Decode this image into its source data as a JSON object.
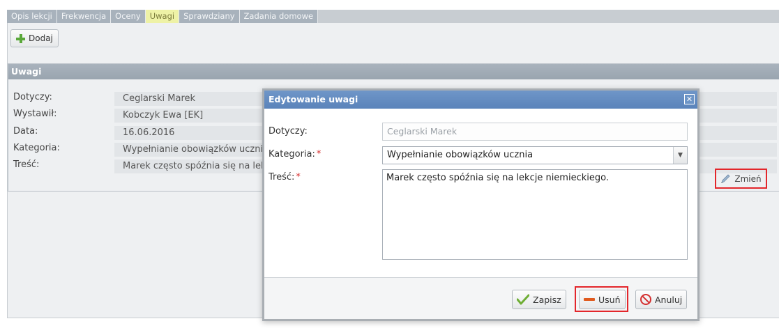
{
  "tabs": [
    {
      "label": "Opis lekcji",
      "active": false
    },
    {
      "label": "Frekwencja",
      "active": false
    },
    {
      "label": "Oceny",
      "active": false
    },
    {
      "label": "Uwagi",
      "active": true
    },
    {
      "label": "Sprawdziany",
      "active": false
    },
    {
      "label": "Zadania domowe",
      "active": false
    }
  ],
  "toolbar": {
    "add_label": "Dodaj",
    "add_icon": "plus-icon"
  },
  "panel": {
    "title": "Uwagi",
    "fields": [
      {
        "label": "Dotyczy:",
        "value": "Ceglarski Marek"
      },
      {
        "label": "Wystawił:",
        "value": "Kobczyk Ewa [EK]"
      },
      {
        "label": "Data:",
        "value": "16.06.2016"
      },
      {
        "label": "Kategoria:",
        "value": "Wypełnianie obowiązków ucznia"
      },
      {
        "label": "Treść:",
        "value": "Marek często spóźnia się na lekcje niemieckiego."
      }
    ],
    "edit_label": "Zmień",
    "edit_icon": "pencil-icon"
  },
  "modal": {
    "title": "Edytowanie uwagi",
    "close_icon": "close-icon",
    "dotyczy_label": "Dotyczy:",
    "dotyczy_value": "Ceglarski Marek",
    "kategoria_label": "Kategoria:",
    "kategoria_value": "Wypełnianie obowiązków ucznia",
    "tresc_label": "Treść:",
    "tresc_value": "Marek często spóźnia się na lekcje niemieckiego.",
    "required_mark": "*",
    "save_label": "Zapisz",
    "delete_label": "Usuń",
    "cancel_label": "Anuluj"
  },
  "colors": {
    "active_tab": "#eef2a6",
    "modal_header": "#6f96c8",
    "highlight": "#e3262b",
    "required": "#d62d2d"
  }
}
